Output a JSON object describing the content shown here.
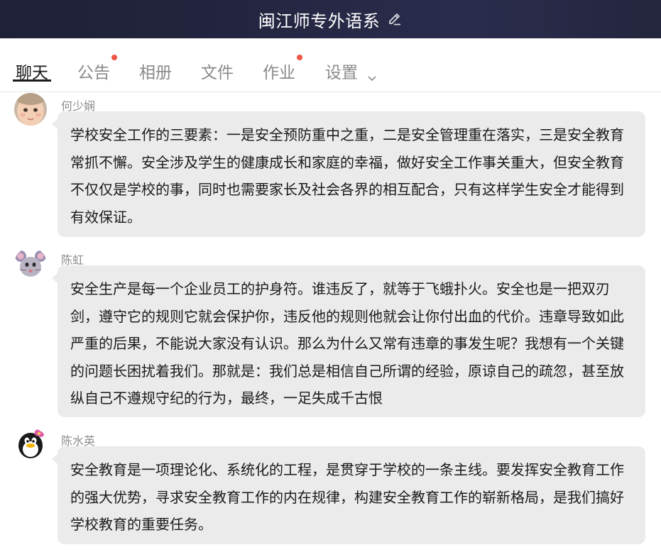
{
  "header": {
    "title": "闽江师专外语系",
    "edit_icon": "pencil-icon"
  },
  "tabs": [
    {
      "label": "聊天",
      "active": true,
      "badge": false
    },
    {
      "label": "公告",
      "active": false,
      "badge": true
    },
    {
      "label": "相册",
      "active": false,
      "badge": false
    },
    {
      "label": "文件",
      "active": false,
      "badge": false
    },
    {
      "label": "作业",
      "active": false,
      "badge": true
    },
    {
      "label": "设置",
      "active": false,
      "badge": false,
      "dropdown": true
    }
  ],
  "colors": {
    "header_bg": "#1f2138",
    "badge": "#ef5545",
    "bubble_bg": "#ebebeb"
  },
  "messages": [
    {
      "sender": "何少娴",
      "avatar": "baby-face-avatar",
      "text": "学校安全工作的三要素：一是安全预防重中之重，二是安全管理重在落实，三是安全教育常抓不懈。安全涉及学生的健康成长和家庭的幸福，做好安全工作事关重大，但安全教育不仅仅是学校的事，同时也需要家长及社会各界的相互配合，只有这样学生安全才能得到有效保证。"
    },
    {
      "sender": "陈虹",
      "avatar": "mouse-avatar",
      "text": "安全生产是每一个企业员工的护身符。谁违反了，就等于飞蛾扑火。安全也是一把双刃剑，遵守它的规则它就会保护你，违反他的规则他就会让你付出血的代价。违章导致如此严重的后果，不能说大家没有认识。那么为什么又常有违章的事发生呢？我想有一个关键的问题长困扰着我们。那就是：我们总是相信自己所谓的经验，原谅自己的疏忽，甚至放纵自己不遵规守纪的行为，最终，一足失成千古恨"
    },
    {
      "sender": "陈水英",
      "avatar": "penguin-avatar",
      "text": "安全教育是一项理论化、系统化的工程，是贯穿于学校的一条主线。要发挥安全教育工作的强大优势，寻求安全教育工作的内在规律，构建安全教育工作的崭新格局，是我们搞好学校教育的重要任务。"
    }
  ]
}
